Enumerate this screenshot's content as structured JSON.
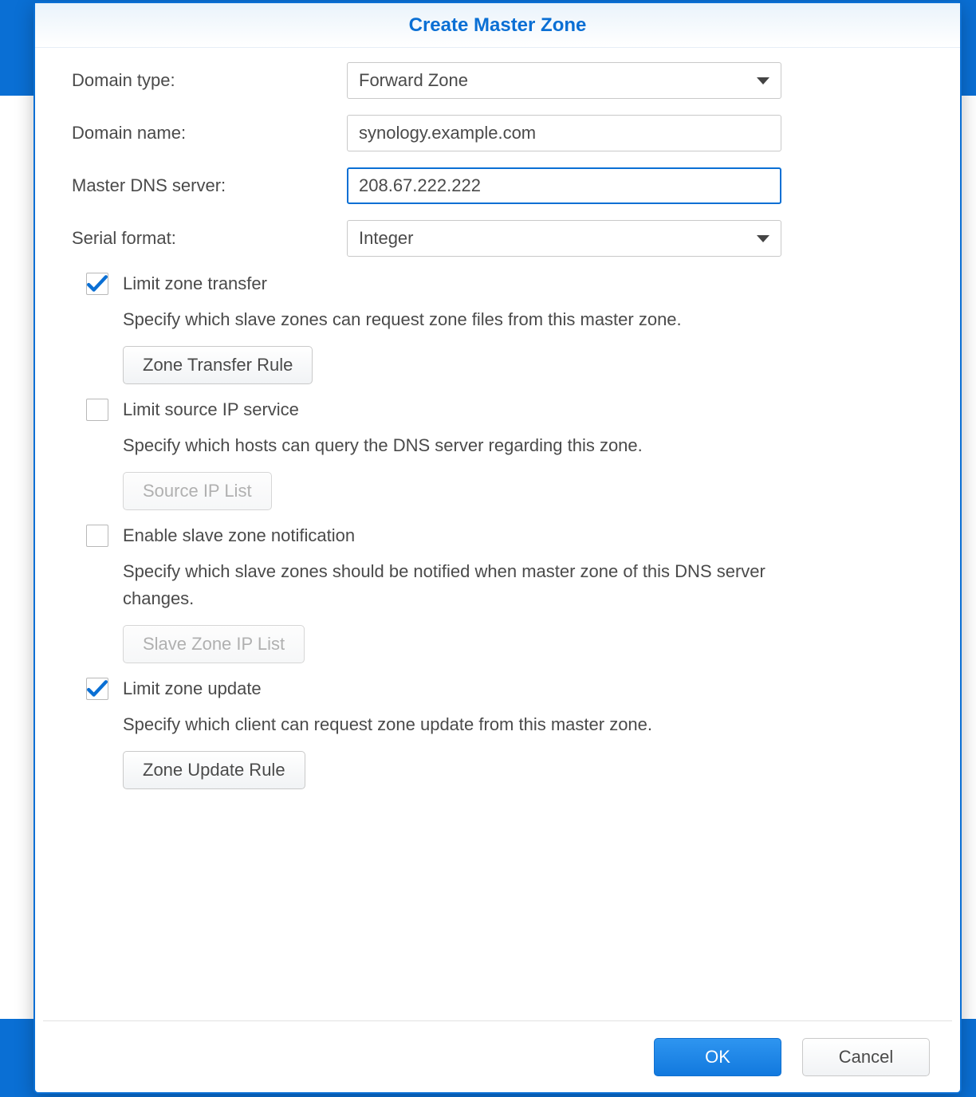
{
  "dialog": {
    "title": "Create Master Zone",
    "fields": {
      "domain_type": {
        "label": "Domain type:",
        "value": "Forward Zone"
      },
      "domain_name": {
        "label": "Domain name:",
        "value": "synology.example.com"
      },
      "master_dns": {
        "label": "Master DNS server:",
        "value": "208.67.222.222"
      },
      "serial_fmt": {
        "label": "Serial format:",
        "value": "Integer"
      }
    },
    "options": {
      "limit_zone_transfer": {
        "checked": true,
        "label": "Limit zone transfer",
        "desc": "Specify which slave zones can request zone files from this master zone.",
        "button": "Zone Transfer Rule",
        "button_enabled": true
      },
      "limit_source_ip": {
        "checked": false,
        "label": "Limit source IP service",
        "desc": "Specify which hosts can query the DNS server regarding this zone.",
        "button": "Source IP List",
        "button_enabled": false
      },
      "enable_slave_notify": {
        "checked": false,
        "label": "Enable slave zone notification",
        "desc": "Specify which slave zones should be notified when master zone of this DNS server changes.",
        "button": "Slave Zone IP List",
        "button_enabled": false
      },
      "limit_zone_update": {
        "checked": true,
        "label": "Limit zone update",
        "desc": "Specify which client can request zone update from this master zone.",
        "button": "Zone Update Rule",
        "button_enabled": true
      }
    },
    "footer": {
      "ok": "OK",
      "cancel": "Cancel"
    }
  }
}
